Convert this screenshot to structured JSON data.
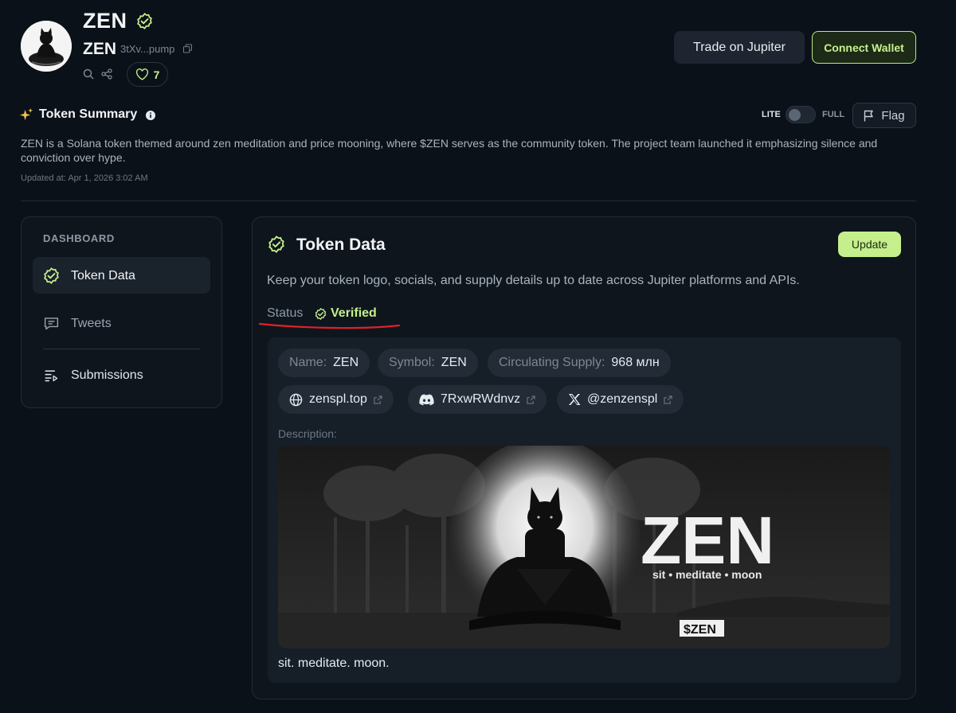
{
  "token": {
    "name": "ZEN",
    "symbol": "ZEN",
    "address_short": "3tXv...pump",
    "likes": "7"
  },
  "header": {
    "trade_label": "Trade on Jupiter",
    "connect_label": "Connect Wallet"
  },
  "summary": {
    "title": "Token Summary",
    "text": "ZEN is a Solana token themed around zen meditation and price mooning, where $ZEN serves as the community token. The project team launched it emphasizing silence and conviction over hype.",
    "updated": "Updated at: Apr 1, 2026 3:02 AM",
    "mode_lite": "LITE",
    "mode_full": "FULL",
    "mode_selected": "LITE",
    "flag_label": "Flag"
  },
  "sidebar": {
    "section_label": "DASHBOARD",
    "items": [
      {
        "label": "Token Data",
        "icon": "verified-badge-icon",
        "active": true
      },
      {
        "label": "Tweets",
        "icon": "message-icon",
        "active": false
      },
      {
        "label": "Submissions",
        "icon": "list-icon",
        "active": false
      }
    ]
  },
  "token_data": {
    "title": "Token Data",
    "update_label": "Update",
    "description": "Keep your token logo, socials, and supply details up to date across Jupiter platforms and APIs.",
    "status_label": "Status",
    "status_value": "Verified",
    "fields": [
      {
        "key": "Name:",
        "value": "ZEN"
      },
      {
        "key": "Symbol:",
        "value": "ZEN"
      },
      {
        "key": "Circulating Supply:",
        "value": "968 млн"
      }
    ],
    "links": [
      {
        "label": "zenspl.top",
        "icon": "globe-icon"
      },
      {
        "label": "7RxwRWdnvz",
        "icon": "discord-icon"
      },
      {
        "label": "@zenzenspl",
        "icon": "x-logo-icon"
      }
    ],
    "description_label": "Description:",
    "banner": {
      "logo_text": "ZEN",
      "tagline": "sit • meditate • moon",
      "ticker": "$ZEN"
    },
    "caption": "sit. meditate. moon."
  },
  "colors": {
    "background": "#0b1118",
    "accent": "#c5ef8c",
    "card": "#0e151d"
  }
}
